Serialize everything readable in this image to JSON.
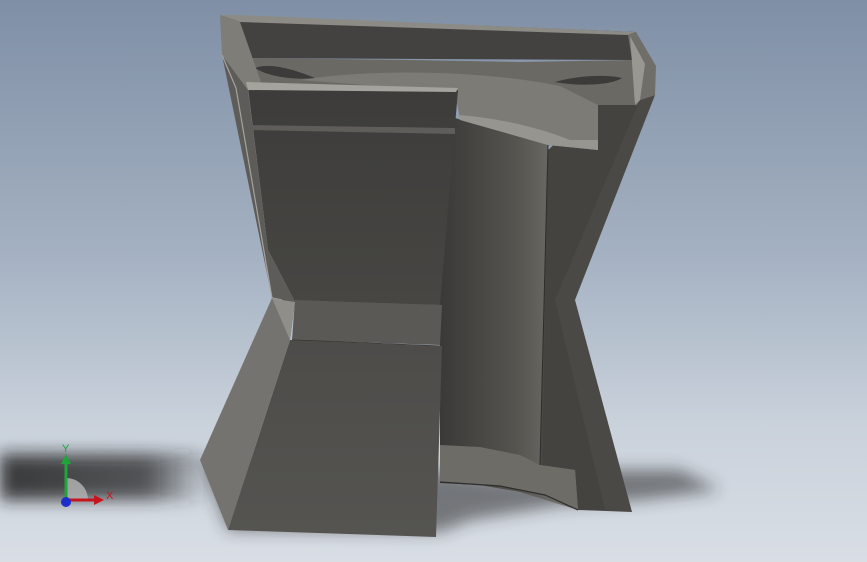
{
  "triad": {
    "x_label": "X",
    "y_label": "Y",
    "colors": {
      "x": "#c8141e",
      "y": "#1fa53a",
      "z": "#1d2fc8"
    }
  },
  "colors": {
    "background_top": "#7f8fa5",
    "background_bottom": "#d9dee5",
    "model_dark": "#3f3e3c",
    "model_mid": "#5a5956",
    "model_light": "#8a8984",
    "shadow": "#262626"
  }
}
